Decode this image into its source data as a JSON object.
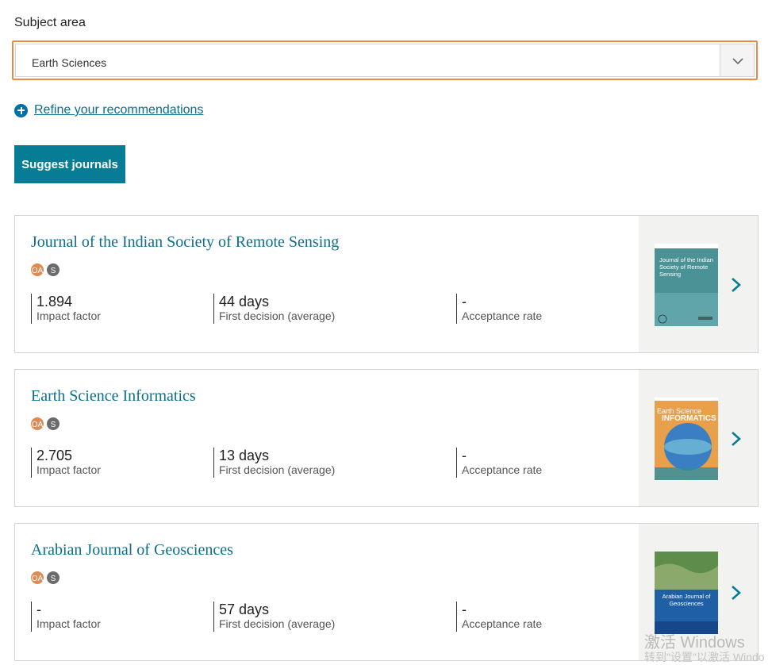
{
  "subject": {
    "label": "Subject area",
    "selected": "Earth Sciences"
  },
  "refine": {
    "label": "Refine your recommendations"
  },
  "suggest_button": "Suggest journals",
  "journals": [
    {
      "title": "Journal of the Indian Society of Remote Sensing",
      "badges": [
        "OA",
        "S"
      ],
      "impact_factor": "1.894",
      "impact_label": "Impact factor",
      "first_decision": "44 days",
      "first_decision_label": "First decision (average)",
      "acceptance": "-",
      "acceptance_label": "Acceptance rate",
      "cover_title": "Journal of the Indian Society of Remote Sensing"
    },
    {
      "title": "Earth Science Informatics",
      "badges": [
        "OA",
        "S"
      ],
      "impact_factor": "2.705",
      "impact_label": "Impact factor",
      "first_decision": "13 days",
      "first_decision_label": "First decision (average)",
      "acceptance": "-",
      "acceptance_label": "Acceptance rate",
      "cover_title_1": "Earth Science",
      "cover_title_2": "INFORMATICS"
    },
    {
      "title": "Arabian Journal of Geosciences",
      "badges": [
        "OA",
        "S"
      ],
      "impact_factor": "-",
      "impact_label": "Impact factor",
      "first_decision": "57 days",
      "first_decision_label": "First decision (average)",
      "acceptance": "-",
      "acceptance_label": "Acceptance rate",
      "cover_title": "Arabian Journal of Geosciences"
    }
  ],
  "watermark": {
    "line1": "激活 Windows",
    "line2": "转到\"设置\"以激活 Windo"
  },
  "colors": {
    "accent": "#077d95",
    "focus_border": "#e98b45",
    "link": "#0c6b8f",
    "oa_badge": "#dd8a55",
    "s_badge": "#6b6b6b"
  }
}
